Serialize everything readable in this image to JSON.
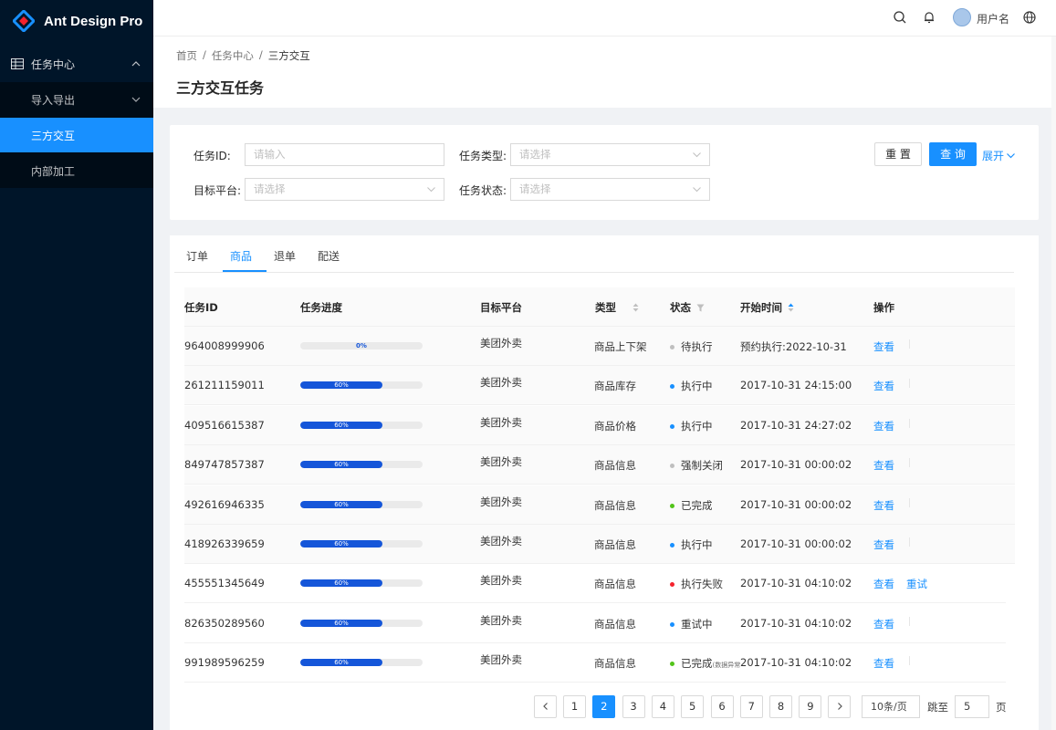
{
  "app": {
    "title": "Ant Design Pro"
  },
  "sidebar": {
    "root_label": "任务中心",
    "items": [
      {
        "label": "导入导出"
      },
      {
        "label": "三方交互"
      },
      {
        "label": "内部加工"
      }
    ]
  },
  "header": {
    "username": "用户名",
    "icons": [
      "search-icon",
      "bell-icon",
      "globe-icon"
    ]
  },
  "breadcrumb": [
    "首页",
    "任务中心",
    "三方交互"
  ],
  "breadcrumb_sep": "/",
  "page_title": "三方交互任务",
  "filters": {
    "task_id": {
      "label": "任务ID:",
      "placeholder": "请输入"
    },
    "task_type": {
      "label": "任务类型:",
      "placeholder": "请选择"
    },
    "platform": {
      "label": "目标平台:",
      "placeholder": "请选择"
    },
    "status": {
      "label": "任务状态:",
      "placeholder": "请选择"
    },
    "reset_label": "重 置",
    "query_label": "查 询",
    "expand_label": "展开"
  },
  "tabs": [
    "订单",
    "商品",
    "退单",
    "配送"
  ],
  "columns": [
    "任务ID",
    "任务进度",
    "目标平台",
    "类型",
    "状态",
    "开始时间",
    "操作"
  ],
  "rows": [
    {
      "id": "964008999906",
      "progress_label": "0%",
      "platform": "美团外卖",
      "type": "商品上下架",
      "status": "待执行",
      "status_color": "#bfbfbf",
      "note": "",
      "time": "预约执行:2022-10-31",
      "action": "查看",
      "retry": ""
    },
    {
      "id": "261211159011",
      "progress_label": "60%",
      "platform": "美团外卖",
      "type": "商品库存",
      "status": "执行中",
      "status_color": "#1890ff",
      "note": "",
      "time": "2017-10-31  24:15:00",
      "action": "查看",
      "retry": ""
    },
    {
      "id": "409516615387",
      "progress_label": "60%",
      "platform": "美团外卖",
      "type": "商品价格",
      "status": "执行中",
      "status_color": "#1890ff",
      "note": "",
      "time": "2017-10-31  24:27:02",
      "action": "查看",
      "retry": ""
    },
    {
      "id": "849747857387",
      "progress_label": "60%",
      "platform": "美团外卖",
      "type": "商品信息",
      "status": "强制关闭",
      "status_color": "#bfbfbf",
      "note": "",
      "time": "2017-10-31  00:00:02",
      "action": "查看",
      "retry": ""
    },
    {
      "id": "492616946335",
      "progress_label": "60%",
      "platform": "美团外卖",
      "type": "商品信息",
      "status": "已完成",
      "status_color": "#52c41a",
      "note": "",
      "time": "2017-10-31  00:00:02",
      "action": "查看",
      "retry": ""
    },
    {
      "id": "418926339659",
      "progress_label": "60%",
      "platform": "美团外卖",
      "type": "商品信息",
      "status": "执行中",
      "status_color": "#1890ff",
      "note": "",
      "time": "2017-10-31  00:00:02",
      "action": "查看",
      "retry": ""
    },
    {
      "id": "455551345649",
      "progress_label": "60%",
      "platform": "美团外卖",
      "type": "商品信息",
      "status": "执行失败",
      "status_color": "#f5222d",
      "note": "",
      "time": "2017-10-31  04:10:02",
      "action": "查看",
      "retry": "重试"
    },
    {
      "id": "826350289560",
      "progress_label": "60%",
      "platform": "美团外卖",
      "type": "商品信息",
      "status": "重试中",
      "status_color": "#1890ff",
      "note": "",
      "time": "2017-10-31  04:10:02",
      "action": "查看",
      "retry": ""
    },
    {
      "id": "991989596259",
      "progress_label": "60%",
      "platform": "美团外卖",
      "type": "商品信息",
      "status": "已完成",
      "status_color": "#52c41a",
      "note": "(数据异常",
      "time": "2017-10-31  04:10:02",
      "action": "查看",
      "retry": ""
    }
  ],
  "progress_values": [
    0,
    0.6,
    0.6,
    0.6,
    0.6,
    0.6,
    0.6,
    0.6,
    0.6
  ],
  "pagination": {
    "pages": [
      "1",
      "2",
      "3",
      "4",
      "5",
      "6",
      "7",
      "8",
      "9"
    ],
    "current": "2",
    "page_size": "10条/页",
    "jump_label": "跳至",
    "jump_value": "5",
    "page_suffix": "页"
  },
  "colors": {
    "primary": "#1890ff",
    "sider": "#001529",
    "progress": "#1556d9"
  }
}
